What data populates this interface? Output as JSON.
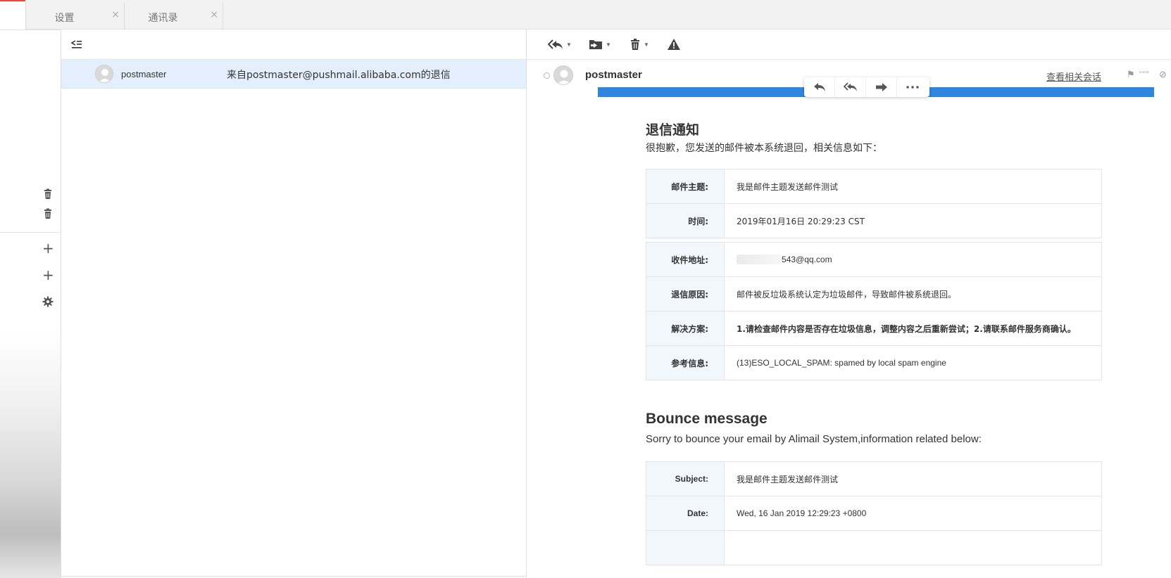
{
  "tabs": [
    {
      "label": "设置",
      "close": "×"
    },
    {
      "label": "通讯录",
      "close": "×"
    }
  ],
  "sidebar": {
    "icons": [
      "trash-icon",
      "trash-icon",
      "plus-icon",
      "plus-icon",
      "gear-icon"
    ],
    "plus": "+"
  },
  "list": {
    "collapse_icon": "collapse-list-icon",
    "rows": [
      {
        "sender": "postmaster",
        "subject": "来自postmaster@pushmail.alibaba.com的退信"
      }
    ]
  },
  "reading": {
    "toolbar": [
      "reply-all-icon",
      "move-to-folder-icon",
      "delete-icon",
      "report-spam-icon"
    ],
    "sender": "postmaster",
    "related_link": "查看相关会话",
    "float_actions": [
      "reply-icon",
      "reply-all-icon",
      "forward-icon",
      "more-icon"
    ],
    "accent_color": "#2f86de",
    "cn": {
      "title": "退信通知",
      "intro": "很抱歉，您发送的邮件被本系统退回，相关信息如下：",
      "table1": [
        {
          "key": "邮件主题:",
          "value": "我是邮件主题发送邮件测试"
        },
        {
          "key": "时间:",
          "value": "2019年01月16日 20:29:23 CST"
        }
      ],
      "table2": [
        {
          "key": "收件地址:",
          "value": "543@qq.com"
        },
        {
          "key": "退信原因:",
          "value": "邮件被反垃圾系统认定为垃圾邮件，导致邮件被系统退回。"
        },
        {
          "key": "解决方案:",
          "value": "1.请检查邮件内容是否存在垃圾信息，调整内容之后重新尝试；2.请联系邮件服务商确认。"
        },
        {
          "key": "参考信息:",
          "value": "(13)ESO_LOCAL_SPAM: spamed by local spam engine"
        }
      ]
    },
    "en": {
      "title": "Bounce message",
      "intro": "Sorry to bounce your email by Alimail System,information related below:",
      "table1": [
        {
          "key": "Subject:",
          "value": "我是邮件主题发送邮件测试"
        },
        {
          "key": "Date:",
          "value": "Wed, 16 Jan 2019 12:29:23 +0800"
        }
      ]
    }
  }
}
